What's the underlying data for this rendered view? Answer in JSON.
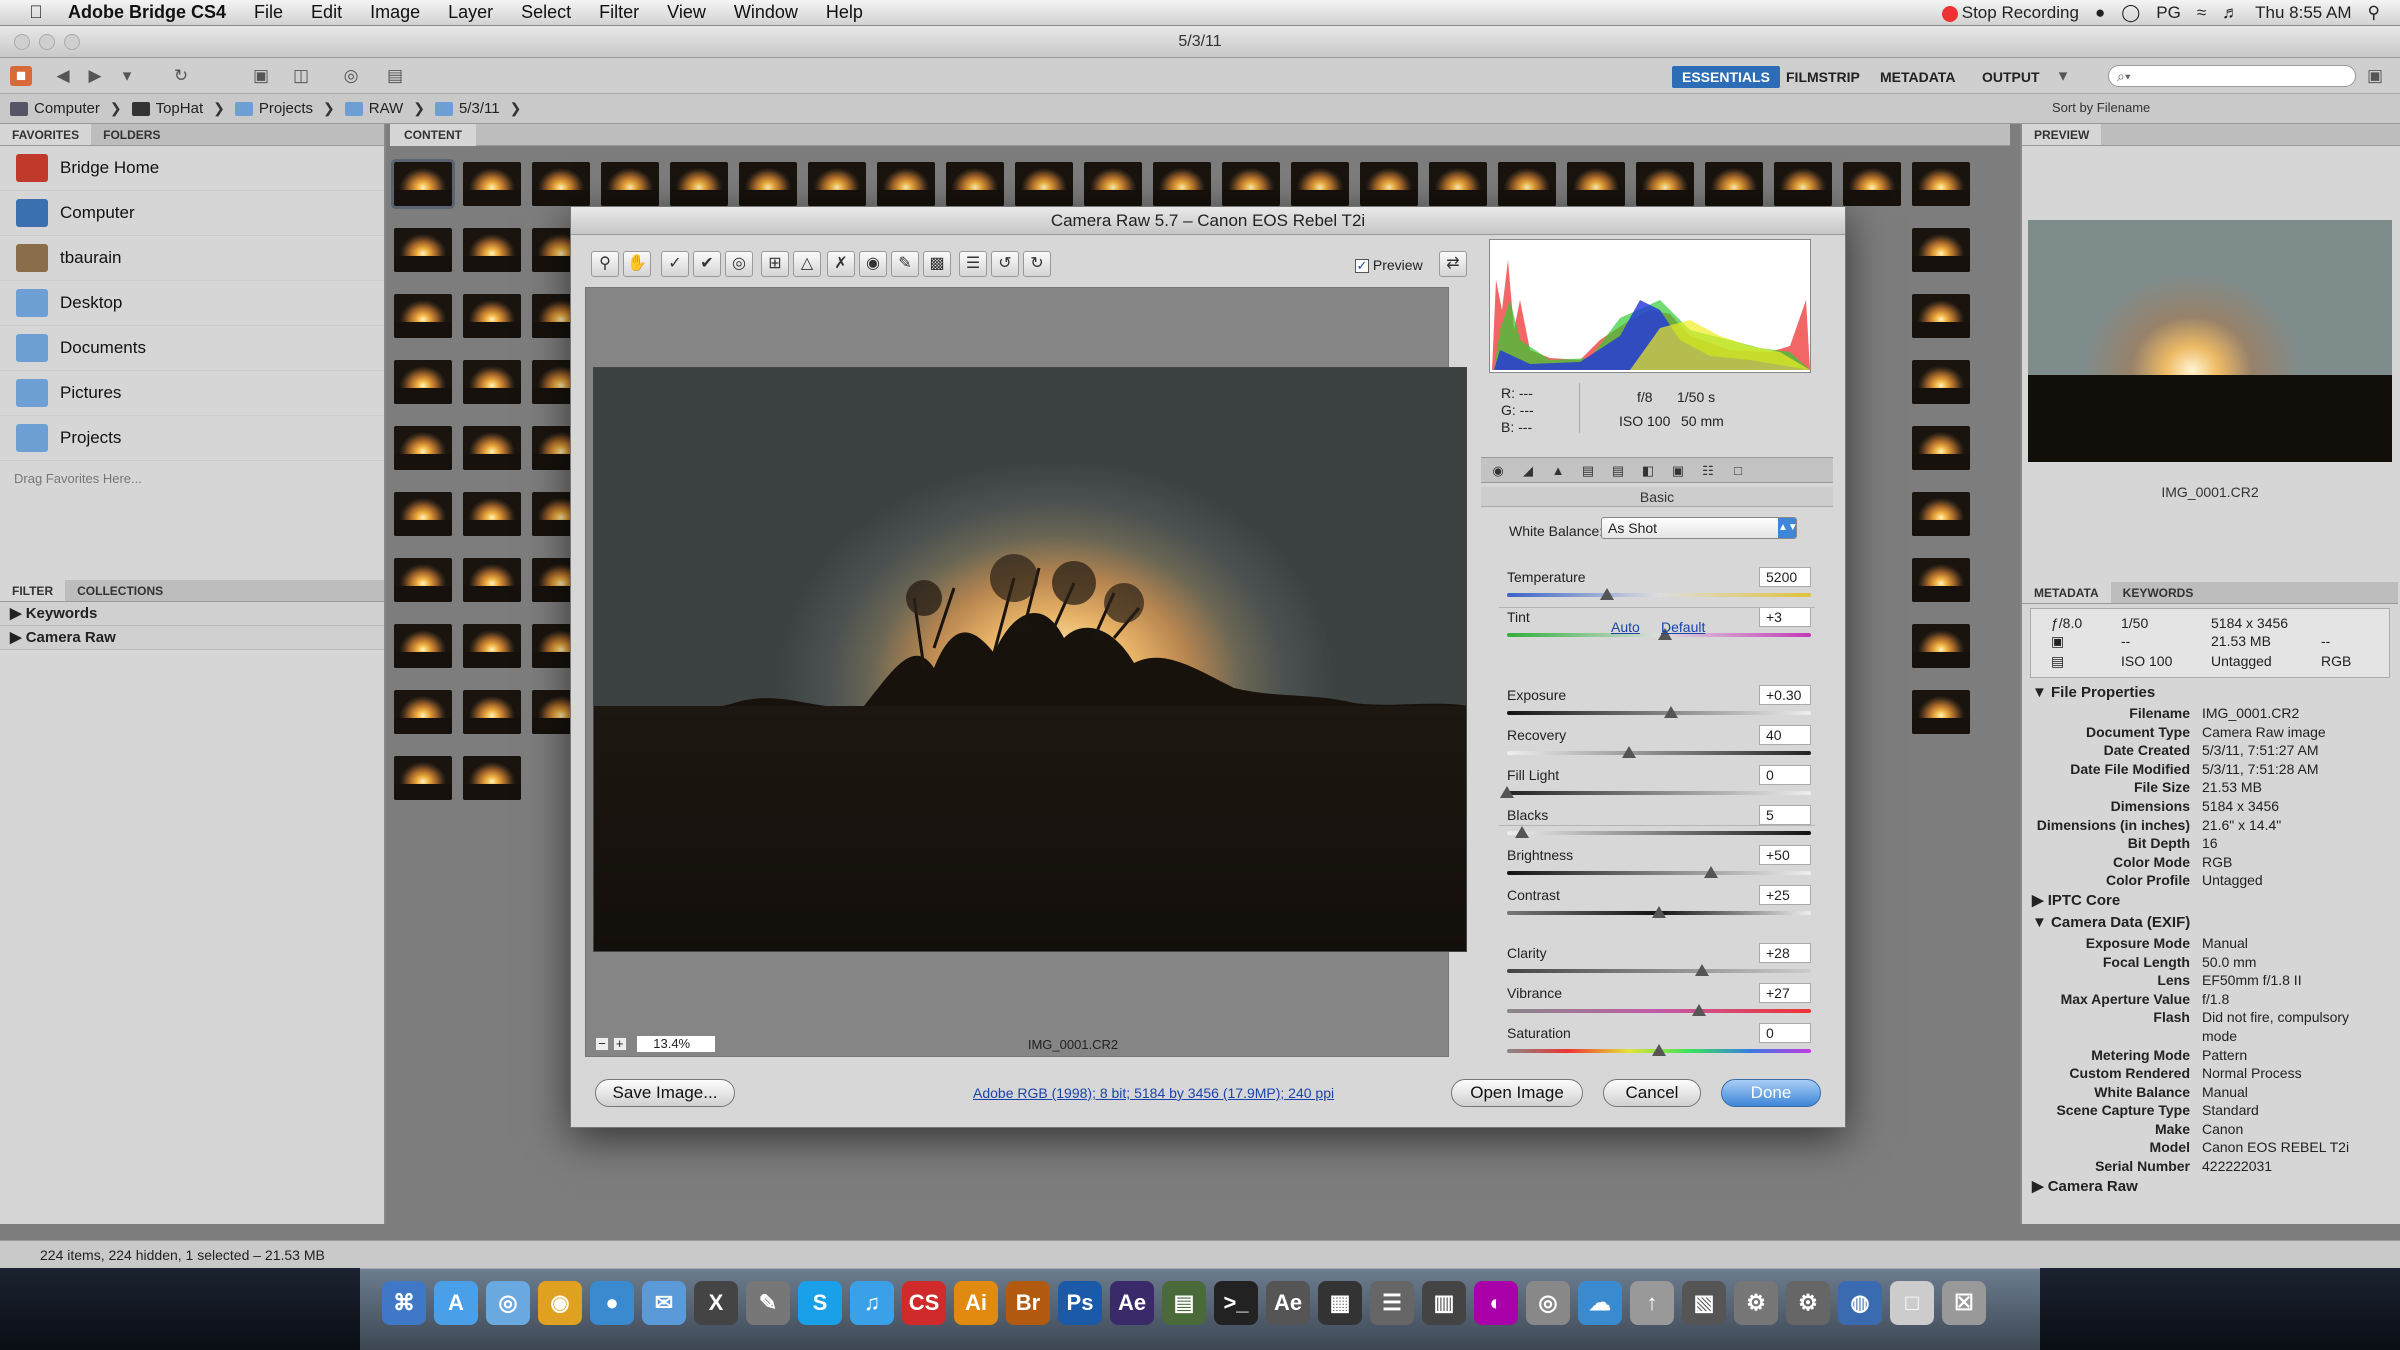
{
  "menubar": {
    "app": "Adobe Bridge CS4",
    "items": [
      "File",
      "Edit",
      "Image",
      "Layer",
      "Select",
      "Filter",
      "View",
      "Window",
      "Help"
    ],
    "stop_recording": "Stop Recording",
    "user": "PG",
    "clock": "Thu 8:55 AM"
  },
  "window": {
    "title": "5/3/11"
  },
  "workspaces": [
    {
      "label": "ESSENTIALS",
      "active": true
    },
    {
      "label": "FILMSTRIP",
      "active": false
    },
    {
      "label": "METADATA",
      "active": false
    },
    {
      "label": "OUTPUT",
      "active": false
    }
  ],
  "search": {
    "placeholder": "⌕▾"
  },
  "path": [
    "Computer",
    "TopHat",
    "Projects",
    "RAW",
    "5/3/11"
  ],
  "sort_label": "Sort by Filename",
  "left": {
    "tabs": [
      "FAVORITES",
      "FOLDERS"
    ],
    "favorites": [
      {
        "label": "Bridge Home",
        "color": "#c0392b"
      },
      {
        "label": "Computer",
        "color": "#3c6fb0"
      },
      {
        "label": "tbaurain",
        "color": "#8a6d4a"
      },
      {
        "label": "Desktop",
        "color": "#6d9fd4"
      },
      {
        "label": "Documents",
        "color": "#6d9fd4"
      },
      {
        "label": "Pictures",
        "color": "#6d9fd4"
      },
      {
        "label": "Projects",
        "color": "#6d9fd4"
      }
    ],
    "drag_hint": "Drag Favorites Here...",
    "filter_tabs": [
      "FILTER",
      "COLLECTIONS"
    ],
    "filters": [
      "Keywords",
      "Camera Raw"
    ]
  },
  "content_tab": "CONTENT",
  "dialog": {
    "title": "Camera Raw 5.7  –  Canon EOS Rebel T2i",
    "preview_label": "Preview",
    "zoom": "13.4%",
    "filename": "IMG_0001.CR2",
    "readout": {
      "r": "R:  ---",
      "g": "G:  ---",
      "b": "B:  ---",
      "aperture": "f/8",
      "shutter": "1/50 s",
      "iso": "ISO 100",
      "focal": "50 mm"
    },
    "panel_name": "Basic",
    "wb_label": "White Balance:",
    "wb_value": "As Shot",
    "auto": "Auto",
    "default": "Default",
    "sliders": [
      {
        "label": "Temperature",
        "value": "5200",
        "pos": 0.33,
        "track": "linear-gradient(90deg,#3a63c9,#ddd,#e0c23a)"
      },
      {
        "label": "Tint",
        "value": "+3",
        "pos": 0.52,
        "track": "linear-gradient(90deg,#2fae3a,#ddd,#c23ab8)"
      },
      {
        "label": "Exposure",
        "value": "+0.30",
        "pos": 0.54,
        "track": "linear-gradient(90deg,#111,#eee)"
      },
      {
        "label": "Recovery",
        "value": "40",
        "pos": 0.4,
        "track": "linear-gradient(90deg,#eee,#222)"
      },
      {
        "label": "Fill Light",
        "value": "0",
        "pos": 0.0,
        "track": "linear-gradient(90deg,#222,#eee)"
      },
      {
        "label": "Blacks",
        "value": "5",
        "pos": 0.05,
        "track": "linear-gradient(90deg,#eee,#111)"
      },
      {
        "label": "Brightness",
        "value": "+50",
        "pos": 0.67,
        "track": "linear-gradient(90deg,#111,#eee)"
      },
      {
        "label": "Contrast",
        "value": "+25",
        "pos": 0.5,
        "track": "linear-gradient(90deg,#777,#111,#eee)"
      },
      {
        "label": "Clarity",
        "value": "+28",
        "pos": 0.64,
        "track": "linear-gradient(90deg,#444,#ccc)"
      },
      {
        "label": "Vibrance",
        "value": "+27",
        "pos": 0.63,
        "track": "linear-gradient(90deg,#888,#c7a",
        "color_note": ""
      },
      {
        "label": "Saturation",
        "value": "0",
        "pos": 0.5,
        "track": "linear-gradient(90deg,#888,#e33,#e3e33a,#3ae35a,#3a7ae3,#c33ae3)"
      }
    ],
    "save_label": "Save Image...",
    "workflow_link": "Adobe RGB (1998); 8 bit; 5184 by 3456 (17.9MP); 240 ppi",
    "open_label": "Open Image",
    "cancel_label": "Cancel",
    "done_label": "Done"
  },
  "right": {
    "preview_tab": "PREVIEW",
    "preview_filename": "IMG_0001.CR2",
    "meta_tabs": [
      "METADATA",
      "KEYWORDS"
    ],
    "summary": {
      "aperture": "ƒ/8.0",
      "shutter": "1/50",
      "dims": "5184 x 3456",
      "size": "21.53 MB",
      "dash1": "--",
      "dash2": "--",
      "iso": "ISO 100",
      "label": "Untagged",
      "mode": "RGB"
    },
    "sections": [
      {
        "name": "File Properties",
        "rows": [
          [
            "Filename",
            "IMG_0001.CR2"
          ],
          [
            "Document Type",
            "Camera Raw image"
          ],
          [
            "Date Created",
            "5/3/11, 7:51:27 AM"
          ],
          [
            "Date File Modified",
            "5/3/11, 7:51:28 AM"
          ],
          [
            "File Size",
            "21.53 MB"
          ],
          [
            "Dimensions",
            "5184 x 3456"
          ],
          [
            "Dimensions (in inches)",
            "21.6\" x 14.4\""
          ],
          [
            "Bit Depth",
            "16"
          ],
          [
            "Color Mode",
            "RGB"
          ],
          [
            "Color Profile",
            "Untagged"
          ]
        ]
      },
      {
        "name": "IPTC Core",
        "rows": []
      },
      {
        "name": "Camera Data (EXIF)",
        "rows": [
          [
            "Exposure Mode",
            "Manual"
          ],
          [
            "Focal Length",
            "50.0 mm"
          ],
          [
            "Lens",
            "EF50mm f/1.8 II"
          ],
          [
            "Max Aperture Value",
            "f/1.8"
          ],
          [
            "Flash",
            "Did not fire, compulsory"
          ],
          [
            "",
            "mode"
          ],
          [
            "Metering Mode",
            "Pattern"
          ],
          [
            "Custom Rendered",
            "Normal Process"
          ],
          [
            "White Balance",
            "Manual"
          ],
          [
            "Scene Capture Type",
            "Standard"
          ],
          [
            "Make",
            "Canon"
          ],
          [
            "Model",
            "Canon EOS REBEL T2i"
          ],
          [
            "Serial Number",
            "422222031"
          ]
        ]
      },
      {
        "name": "Camera Raw",
        "rows": []
      }
    ]
  },
  "status": "224 items, 224 hidden, 1 selected – 21.53 MB",
  "dock": [
    {
      "label": "⌘",
      "color": "#3e78c6"
    },
    {
      "label": "A",
      "color": "#4aa0e8"
    },
    {
      "label": "◎",
      "color": "#6aa8e0"
    },
    {
      "label": "◉",
      "color": "#e0a020"
    },
    {
      "label": "●",
      "color": "#3a8ad0"
    },
    {
      "label": "✉",
      "color": "#5a9ad8"
    },
    {
      "label": "X",
      "color": "#444"
    },
    {
      "label": "✎",
      "color": "#777"
    },
    {
      "label": "S",
      "color": "#1aa0e8"
    },
    {
      "label": "♫",
      "color": "#3aa0e8"
    },
    {
      "label": "CS",
      "color": "#d02a2a"
    },
    {
      "label": "Ai",
      "color": "#e08a10"
    },
    {
      "label": "Br",
      "color": "#b25a10"
    },
    {
      "label": "Ps",
      "color": "#1a5aa8"
    },
    {
      "label": "Ae",
      "color": "#3a2a6a"
    },
    {
      "label": "▤",
      "color": "#4a6a3a"
    },
    {
      "label": ">_",
      "color": "#222"
    },
    {
      "label": "Ae",
      "color": "#555"
    },
    {
      "label": "▦",
      "color": "#333"
    },
    {
      "label": "☰",
      "color": "#666"
    },
    {
      "label": "▥",
      "color": "#444"
    },
    {
      "label": "◐",
      "color": "#a0a"
    },
    {
      "label": "◎",
      "color": "#888"
    },
    {
      "label": "☁",
      "color": "#3a8ad0"
    },
    {
      "label": "↑",
      "color": "#999"
    },
    {
      "label": "▧",
      "color": "#555"
    },
    {
      "label": "⚙",
      "color": "#777"
    },
    {
      "label": "⚙",
      "color": "#666"
    },
    {
      "label": "◍",
      "color": "#3a6ab0"
    },
    {
      "label": "□",
      "color": "#ccc"
    },
    {
      "label": "☒",
      "color": "#999"
    }
  ]
}
